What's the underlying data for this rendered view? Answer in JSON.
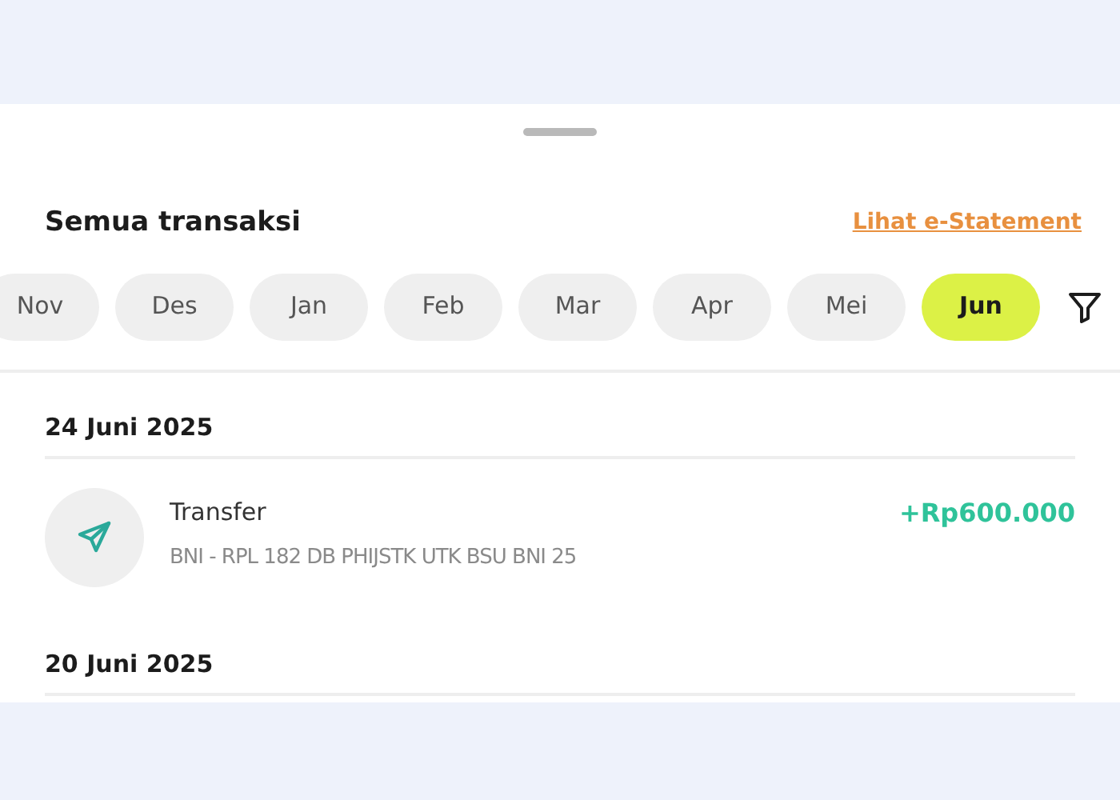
{
  "header": {
    "title": "Semua transaksi",
    "link": "Lihat e-Statement"
  },
  "months": [
    {
      "label": "Nov",
      "selected": false
    },
    {
      "label": "Des",
      "selected": false
    },
    {
      "label": "Jan",
      "selected": false
    },
    {
      "label": "Feb",
      "selected": false
    },
    {
      "label": "Mar",
      "selected": false
    },
    {
      "label": "Apr",
      "selected": false
    },
    {
      "label": "Mei",
      "selected": false
    },
    {
      "label": "Jun",
      "selected": true
    }
  ],
  "groups": [
    {
      "date": "24 Juni 2025",
      "transactions": [
        {
          "title": "Transfer",
          "description": "BNI - RPL 182 DB PHIJSTK UTK BSU BNI 25",
          "amount": "+Rp600.000"
        }
      ]
    },
    {
      "date": "20 Juni 2025"
    }
  ]
}
